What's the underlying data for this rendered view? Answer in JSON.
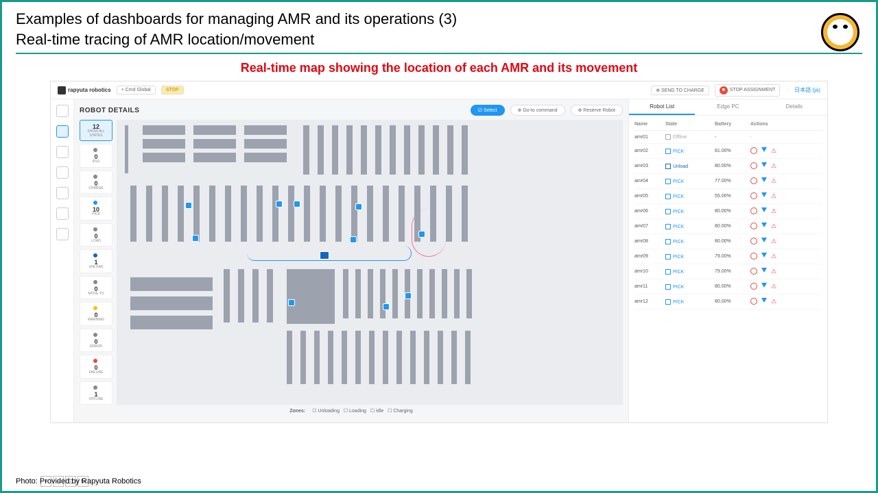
{
  "slide": {
    "title1": "Examples of dashboards for managing AMR and its operations (3)",
    "title2": "Real-time tracing of AMR location/movement",
    "caption": "Real-time map showing the location of each AMR and its movement",
    "credit": "Photo: Provided by Rapyuta Robotics"
  },
  "topbar": {
    "brand": "rapyuta robotics",
    "cmd_global": "+ Cmd Global",
    "stop": "STOP",
    "send_to_charge": "SEND TO CHARGE",
    "stop_assignment": "STOP ASSIGNMENT",
    "lang": "日本語 (ja)"
  },
  "details": {
    "heading": "ROBOT DETAILS",
    "select": "Select",
    "goto_cmd": "⊕ Go-to command",
    "reserve": "⊕ Reserve Robot"
  },
  "states": [
    {
      "num": "12",
      "label": "SHOW ALL STATES",
      "active": true,
      "color": ""
    },
    {
      "num": "0",
      "label": "IDLE",
      "color": "#888"
    },
    {
      "num": "0",
      "label": "CHARGE",
      "color": "#888"
    },
    {
      "num": "10",
      "label": "PICK",
      "color": "#2196f3"
    },
    {
      "num": "0",
      "label": "LOAD",
      "color": "#888"
    },
    {
      "num": "1",
      "label": "UNLOAD",
      "color": "#1565c0"
    },
    {
      "num": "0",
      "label": "MOVE TO",
      "color": "#888"
    },
    {
      "num": "0",
      "label": "WARNING",
      "color": "#f1c40f"
    },
    {
      "num": "0",
      "label": "ERROR",
      "color": "#888"
    },
    {
      "num": "0",
      "label": "FAILURE",
      "color": "#e74c3c"
    },
    {
      "num": "1",
      "label": "OFFLINE",
      "color": "#888"
    }
  ],
  "zones": {
    "label": "Zones:",
    "items": [
      "Unloading",
      "Loading",
      "Idle",
      "Charging"
    ]
  },
  "zoom": {
    "in": "+",
    "out": "−",
    "fit": "⊡",
    "reset": "↻"
  },
  "tabs": [
    "Robot List",
    "Edge PC",
    "Details"
  ],
  "table": {
    "headers": {
      "name": "Name",
      "state": "State",
      "battery": "Battery",
      "actions": "Actions"
    },
    "rows": [
      {
        "name": "amr01",
        "state": "Offline",
        "stateClass": "off",
        "battery": "-",
        "actions": false
      },
      {
        "name": "amr02",
        "state": "PICK",
        "stateClass": "pick",
        "battery": "81.00%",
        "actions": true
      },
      {
        "name": "amr03",
        "state": "Unload",
        "stateClass": "unload",
        "battery": "80.00%",
        "actions": true
      },
      {
        "name": "amr04",
        "state": "PICK",
        "stateClass": "pick",
        "battery": "77.00%",
        "actions": true
      },
      {
        "name": "amr05",
        "state": "PICK",
        "stateClass": "pick",
        "battery": "55.00%",
        "actions": true
      },
      {
        "name": "amr06",
        "state": "PICK",
        "stateClass": "pick",
        "battery": "80.00%",
        "actions": true
      },
      {
        "name": "amr07",
        "state": "PICK",
        "stateClass": "pick",
        "battery": "80.00%",
        "actions": true
      },
      {
        "name": "amr08",
        "state": "PICK",
        "stateClass": "pick",
        "battery": "80.00%",
        "actions": true
      },
      {
        "name": "amr09",
        "state": "PICK",
        "stateClass": "pick",
        "battery": "79.00%",
        "actions": true
      },
      {
        "name": "amr10",
        "state": "PICK",
        "stateClass": "pick",
        "battery": "79.00%",
        "actions": true
      },
      {
        "name": "amr11",
        "state": "PICK",
        "stateClass": "pick",
        "battery": "80.00%",
        "actions": true
      },
      {
        "name": "amr12",
        "state": "PICK",
        "stateClass": "pick",
        "battery": "80.00%",
        "actions": true
      }
    ]
  }
}
